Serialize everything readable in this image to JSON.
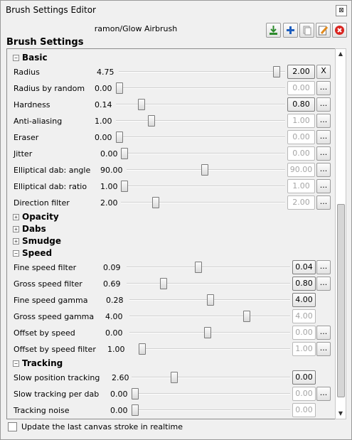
{
  "window": {
    "title": "Brush Settings Editor",
    "close_symbol": "⊠"
  },
  "toolbar": {
    "brush_name": "ramon/Glow Airbrush"
  },
  "heading": "Brush Settings",
  "sections": {
    "basic": {
      "label": "Basic",
      "toggle": "−"
    },
    "opacity": {
      "label": "Opacity",
      "toggle": "+"
    },
    "dabs": {
      "label": "Dabs",
      "toggle": "+"
    },
    "smudge": {
      "label": "Smudge",
      "toggle": "+"
    },
    "speed": {
      "label": "Speed",
      "toggle": "−"
    },
    "tracking": {
      "label": "Tracking",
      "toggle": "−"
    }
  },
  "settings": [
    {
      "label": "Radius",
      "value": "4.75",
      "box": "2.00",
      "button": "X",
      "slider": 0.99
    },
    {
      "label": "Radius by random",
      "value": "0.00",
      "box": "0.00",
      "button": "...",
      "slider": 0.0
    },
    {
      "label": "Hardness",
      "value": "0.14",
      "box": "0.80",
      "button": "...",
      "slider": 0.14
    },
    {
      "label": "Anti-aliasing",
      "value": "1.00",
      "box": "1.00",
      "button": "...",
      "slider": 0.2
    },
    {
      "label": "Eraser",
      "value": "0.00",
      "box": "0.00",
      "button": "...",
      "slider": 0.0
    },
    {
      "label": "Jitter",
      "value": "0.00",
      "box": "0.00",
      "button": "...",
      "slider": 0.0
    },
    {
      "label": "Elliptical dab: angle",
      "value": "90.00",
      "box": "90.00",
      "button": "...",
      "slider": 0.5
    },
    {
      "label": "Elliptical dab: ratio",
      "value": "1.00",
      "box": "1.00",
      "button": "...",
      "slider": 0.0
    },
    {
      "label": "Direction filter",
      "value": "2.00",
      "box": "2.00",
      "button": "...",
      "slider": 0.2
    },
    {
      "label": "Fine speed filter",
      "value": "0.09",
      "box": "0.04",
      "button": "...",
      "slider": 0.43
    },
    {
      "label": "Gross speed filter",
      "value": "0.69",
      "box": "0.80",
      "button": "...",
      "slider": 0.18
    },
    {
      "label": "Fine speed gamma",
      "value": "0.28",
      "box": "4.00",
      "button": "",
      "slider": 0.5
    },
    {
      "label": "Gross speed gamma",
      "value": "4.00",
      "box": "4.00",
      "button": "",
      "slider": 0.8
    },
    {
      "label": "Offset by speed",
      "value": "0.00",
      "box": "0.00",
      "button": "...",
      "slider": 0.5
    },
    {
      "label": "Offset by speed filter",
      "value": "1.00",
      "box": "1.00",
      "button": "...",
      "slider": 0.0
    },
    {
      "label": "Slow position tracking",
      "value": "2.60",
      "box": "0.00",
      "button": "",
      "slider": 0.25
    },
    {
      "label": "Slow tracking per dab",
      "value": "0.00",
      "box": "0.00",
      "button": "...",
      "slider": 0.0
    },
    {
      "label": "Tracking noise",
      "value": "0.00",
      "box": "0.00",
      "button": "",
      "slider": 0.0
    }
  ],
  "scrollbar": {
    "up": "▲",
    "down": "▼"
  },
  "footer": {
    "realtime_label": "Update the last canvas stroke in realtime"
  }
}
